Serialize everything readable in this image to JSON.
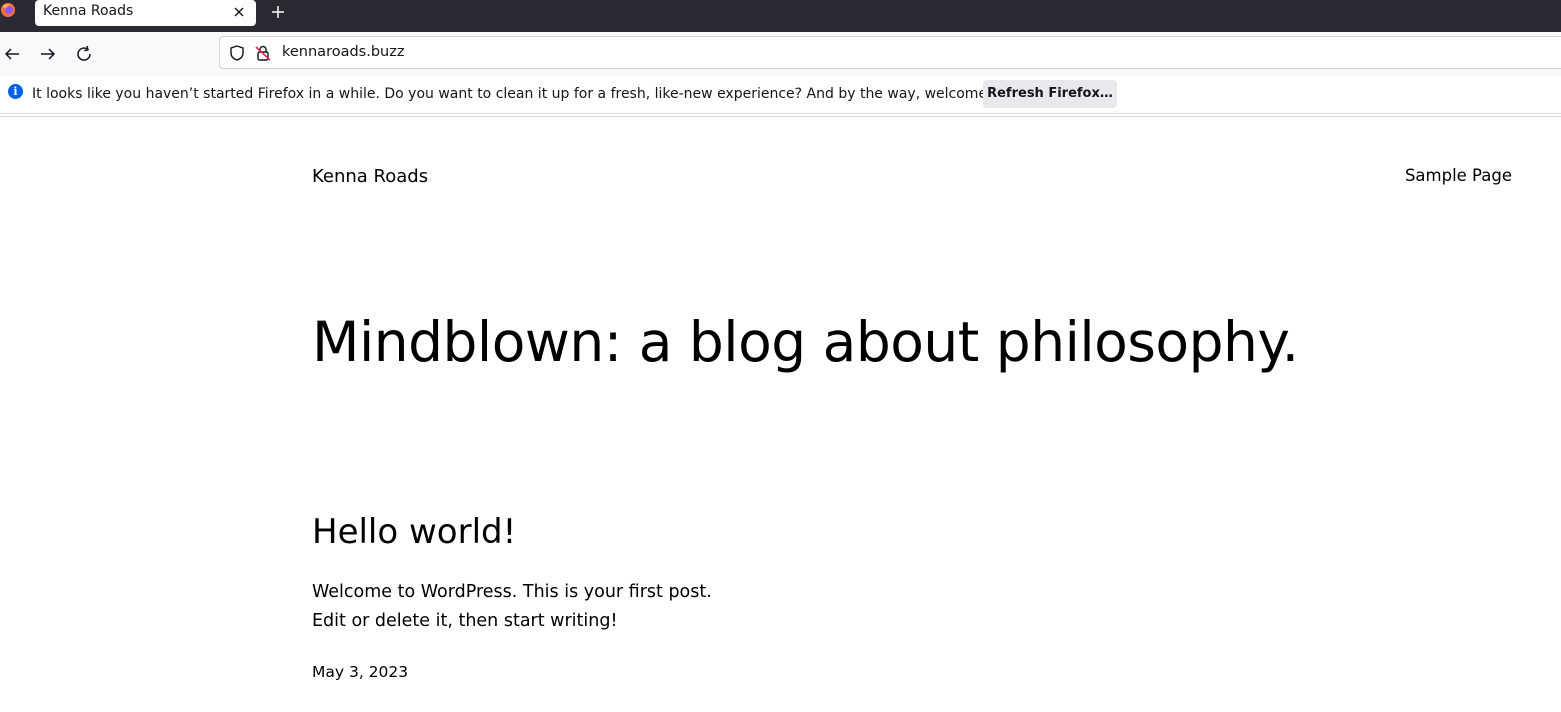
{
  "browser": {
    "tab": {
      "title": "Kenna Roads"
    },
    "url": "kennaroads.buzz",
    "icons": [
      "firefox-logo-icon",
      "close-icon",
      "plus-icon",
      "back-arrow-icon",
      "forward-arrow-icon",
      "reload-icon",
      "shield-icon",
      "insecure-lock-icon",
      "info-icon"
    ],
    "notification": {
      "message": "It looks like you haven’t started Firefox in a while. Do you want to clean it up for a fresh, like-new experience? And by the way, welcome back!",
      "button_label": "Refresh Firefox…"
    }
  },
  "site": {
    "title": "Kenna Roads",
    "nav": [
      {
        "label": "Sample Page"
      }
    ],
    "tagline": "Mindblown: a blog about philosophy."
  },
  "post": {
    "title": "Hello world!",
    "excerpt_lines": [
      "Welcome to WordPress. This is your first post.",
      "Edit or delete it, then start writing!"
    ],
    "date": "May 3, 2023"
  },
  "colors": {
    "tabstrip_bg": "#2b2a33",
    "navbar_bg": "#f9f9fb",
    "info_blue": "#0060df",
    "button_bg": "#e9e9ed"
  }
}
